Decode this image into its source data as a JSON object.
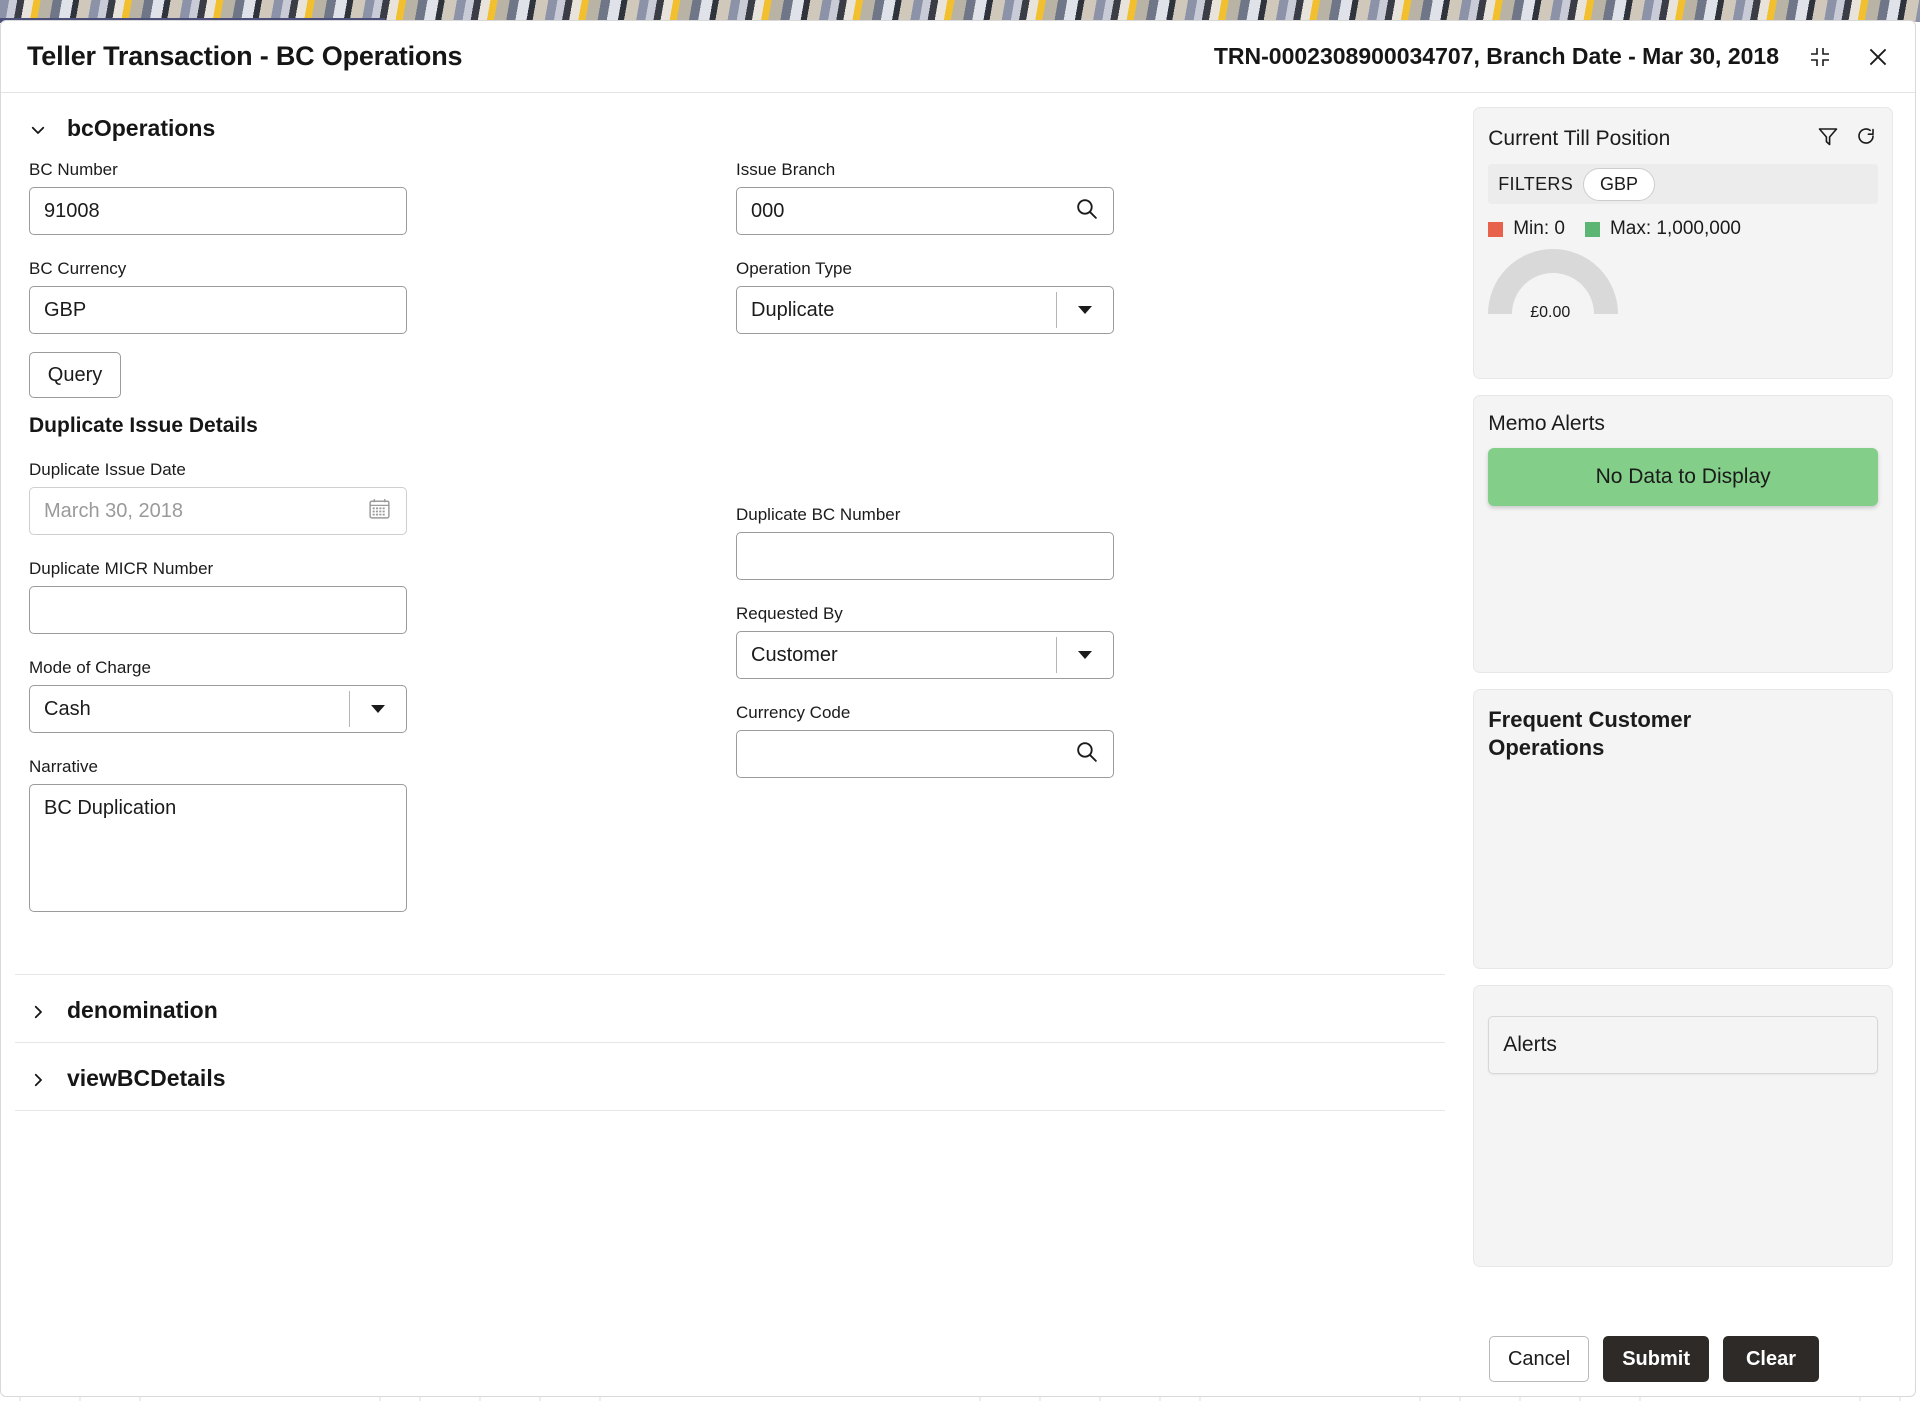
{
  "window": {
    "title": "Teller Transaction - BC Operations",
    "subtitle": "TRN-0002308900034707, Branch Date - Mar 30, 2018",
    "minimize_icon": "restore-down-icon",
    "close_icon": "close-icon"
  },
  "sections": [
    {
      "id": "bcOperations",
      "label": "bcOperations",
      "expanded": true,
      "chevron": "chevron-down-icon"
    },
    {
      "id": "denomination",
      "label": "denomination",
      "expanded": false,
      "chevron": "chevron-right-icon"
    },
    {
      "id": "viewBCDetails",
      "label": "viewBCDetails",
      "expanded": false,
      "chevron": "chevron-right-icon"
    }
  ],
  "form": {
    "bc_number": {
      "label": "BC Number",
      "value": "91008"
    },
    "bc_currency": {
      "label": "BC Currency",
      "value": "GBP"
    },
    "issue_branch": {
      "label": "Issue Branch",
      "value": "000",
      "icon": "search-icon"
    },
    "operation_type": {
      "label": "Operation Type",
      "value": "Duplicate",
      "icon": "dropdown-arrow-icon"
    },
    "query_button": "Query",
    "duplicate_issue_details": "Duplicate Issue Details",
    "duplicate_issue_date": {
      "label": "Duplicate Issue Date",
      "value": "March 30, 2018",
      "icon": "calendar-icon"
    },
    "duplicate_bc_number": {
      "label": "Duplicate BC Number",
      "value": ""
    },
    "duplicate_micr_number": {
      "label": "Duplicate MICR Number",
      "value": ""
    },
    "requested_by": {
      "label": "Requested By",
      "value": "Customer",
      "icon": "dropdown-arrow-icon"
    },
    "mode_of_charge": {
      "label": "Mode of Charge",
      "value": "Cash",
      "icon": "dropdown-arrow-icon"
    },
    "currency_code": {
      "label": "Currency Code",
      "value": "",
      "icon": "search-icon"
    },
    "narrative": {
      "label": "Narrative",
      "value": "BC Duplication"
    }
  },
  "sidebar": {
    "till_position": {
      "title": "Current Till Position",
      "filter_icon": "filter-funnel-icon",
      "refresh_icon": "refresh-icon",
      "filters_label": "FILTERS",
      "filter_pill": "GBP",
      "min_label": "Min: 0",
      "max_label": "Max: 1,000,000",
      "min_color": "#e8614a",
      "max_color": "#5cb573",
      "gauge_value": "£0.00",
      "gauge_track_color": "#d9d9d9"
    },
    "memo_alerts": {
      "title": "Memo Alerts",
      "banner_text": "No Data to Display",
      "banner_color": "#83ce88"
    },
    "frequent_customer_operations": {
      "title": "Frequent Customer Operations"
    },
    "alerts": {
      "title": "Alerts"
    }
  },
  "footer": {
    "cancel": "Cancel",
    "submit": "Submit",
    "clear": "Clear"
  }
}
